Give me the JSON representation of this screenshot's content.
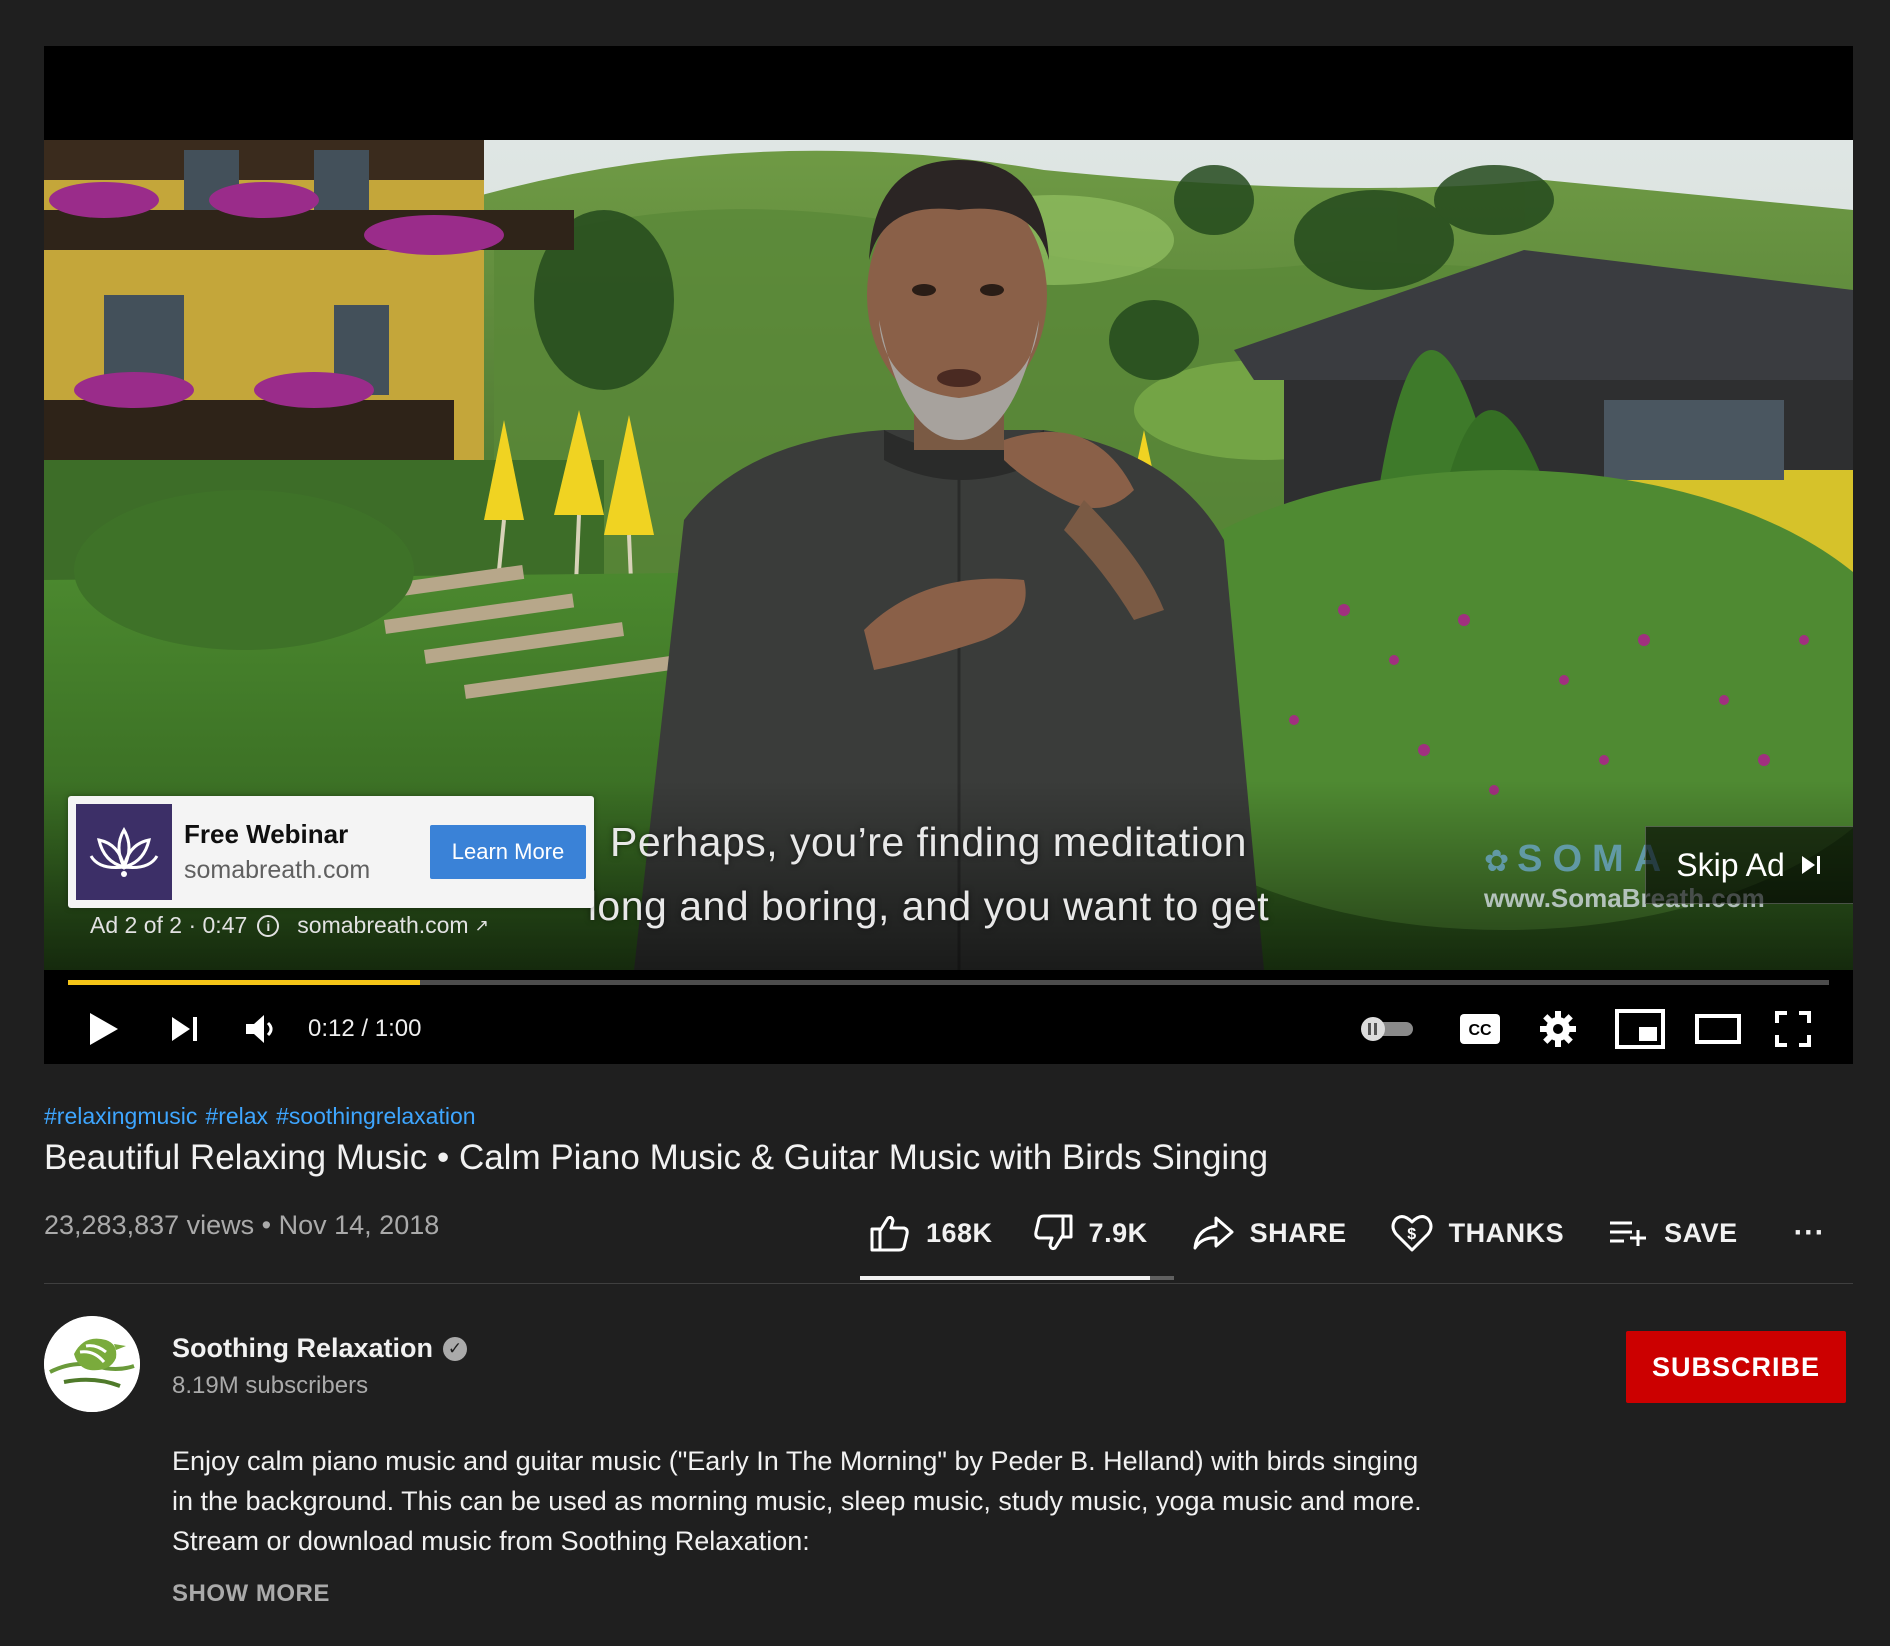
{
  "player": {
    "captions": {
      "line1": "Perhaps, you’re finding meditation",
      "line2": "long and boring, and you want to get"
    },
    "watermark": {
      "logo_text": "SOMA",
      "url": "www.SomaBreath.com"
    },
    "ad": {
      "title": "Free Webinar",
      "domain": "somabreath.com",
      "cta_label": "Learn More",
      "position": "Ad 2 of 2 · 0:47",
      "link_text": "somabreath.com",
      "skip_label": "Skip Ad"
    },
    "progress_fraction": 0.2,
    "progress_color": "#f5c518",
    "time_display": "0:12 / 1:00",
    "controls": {
      "play_icon": "play-icon",
      "next_icon": "next-icon",
      "volume_icon": "volume-icon",
      "autoplay_icon": "autoplay-toggle-icon",
      "cc_label": "CC",
      "settings_icon": "gear-icon",
      "miniplayer_icon": "miniplayer-icon",
      "theater_icon": "theater-icon",
      "fullscreen_icon": "fullscreen-icon"
    }
  },
  "video": {
    "hashtags": [
      "#relaxingmusic",
      "#relax",
      "#soothingrelaxation"
    ],
    "title": "Beautiful Relaxing Music • Calm Piano Music & Guitar Music with Birds Singing",
    "views": "23,283,837 views",
    "date": "Nov 14, 2018"
  },
  "actions": {
    "likes": "168K",
    "dislikes": "7.9K",
    "share": "SHARE",
    "thanks": "THANKS",
    "save": "SAVE",
    "more": "···",
    "like_ratio": 0.925
  },
  "channel": {
    "name": "Soothing Relaxation",
    "subscribers": "8.19M subscribers",
    "subscribe_label": "SUBSCRIBE",
    "subscribe_color": "#cc0000"
  },
  "description": {
    "text": "Enjoy calm piano music and guitar music (\"Early In The Morning\" by Peder B. Helland) with birds singing in the background. This can be used as morning music, sleep music, study music, yoga music and more. Stream or download music from Soothing Relaxation:",
    "show_more": "SHOW MORE"
  },
  "colors": {
    "background": "#1f1f1f",
    "link": "#3ea6ff",
    "learn_more": "#3a82d7"
  }
}
